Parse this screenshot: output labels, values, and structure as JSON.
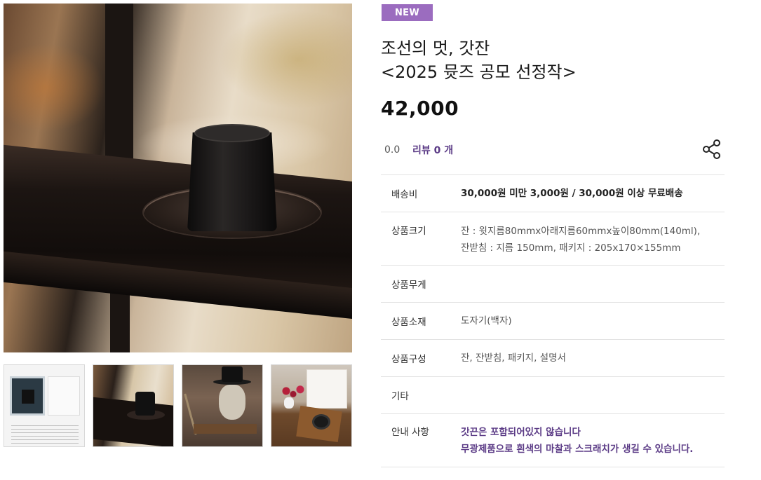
{
  "product": {
    "badge": "NEW",
    "title_line1": "조선의 멋, 갓잔",
    "title_line2": "<2025 뮷즈 공모 선정작>",
    "price": "42,000",
    "rating": "0.0",
    "review_label": "리뷰 0 개"
  },
  "specs": [
    {
      "label": "배송비",
      "value": "30,000원 미만 3,000원 / 30,000원 이상 무료배송"
    },
    {
      "label": "상품크기",
      "value_line1": "잔 : 윗지름80mmx아래지름60mmx높이80mm(140ml),",
      "value_line2": "잔받침 : 지름 150mm, 패키지 : 205x170×155mm"
    },
    {
      "label": "상품무게",
      "value": ""
    },
    {
      "label": "상품소재",
      "value": "도자기(백자)"
    },
    {
      "label": "상품구성",
      "value": "잔, 잔받침, 패키지, 설명서"
    },
    {
      "label": "기타",
      "value": ""
    },
    {
      "label": "안내 사항",
      "value_line1": "갓끈은 포함되어있지 않습니다",
      "value_line2": "무광제품으로 흰색의 마찰과 스크래치가 생길 수 있습니다."
    }
  ],
  "colors": {
    "badge": "#9b6cbf",
    "accent_purple": "#5b3b86"
  },
  "icons": {
    "share": "share-icon"
  }
}
